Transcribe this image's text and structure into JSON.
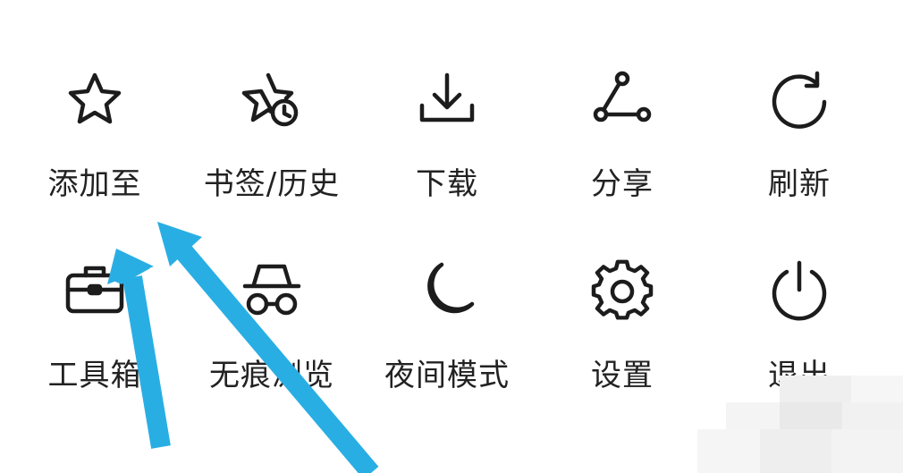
{
  "menu": {
    "items": [
      {
        "label": "添加至",
        "icon": "star-icon"
      },
      {
        "label": "书签/历史",
        "icon": "star-clock-icon"
      },
      {
        "label": "下载",
        "icon": "download-icon"
      },
      {
        "label": "分享",
        "icon": "share-icon"
      },
      {
        "label": "刷新",
        "icon": "refresh-icon"
      },
      {
        "label": "工具箱",
        "icon": "toolbox-icon"
      },
      {
        "label": "无痕浏览",
        "icon": "incognito-icon"
      },
      {
        "label": "夜间模式",
        "icon": "moon-icon"
      },
      {
        "label": "设置",
        "icon": "gear-icon"
      },
      {
        "label": "退出",
        "icon": "power-icon"
      }
    ]
  },
  "colors": {
    "icon_stroke": "#1c1c1c",
    "arrow": "#29aee4",
    "background": "#ffffff"
  }
}
